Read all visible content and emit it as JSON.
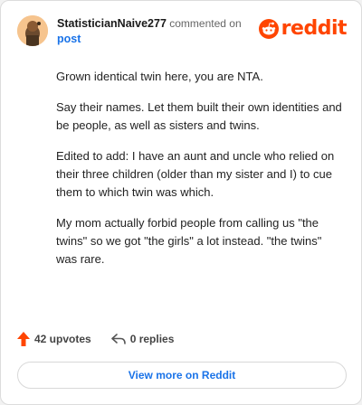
{
  "header": {
    "username": "StatisticianNaive277",
    "commented_text": "commented on",
    "post_link": "post",
    "brand": "reddit",
    "avatar_icon": "avatar-icon",
    "logo_icon": "reddit-logo-icon"
  },
  "comment": {
    "paragraphs": [
      "Grown identical twin here, you are NTA.",
      "Say their names. Let them built their own identities and be people, as well as sisters and twins.",
      "Edited to add: I have an aunt and uncle who relied on their three children (older than my sister and I) to cue them to which twin was which.",
      "My mom actually forbid people from calling us \"the twins\" so we got \"the girls\" a lot instead. \"the twins\" was rare."
    ]
  },
  "actions": {
    "upvotes": "42 upvotes",
    "replies": "0 replies",
    "upvote_icon": "upvote-arrow-icon",
    "reply_icon": "reply-arrow-icon"
  },
  "footer": {
    "view_more": "View more on Reddit"
  },
  "colors": {
    "brand": "#ff4500",
    "link": "#1a73e8",
    "text": "#222222"
  }
}
